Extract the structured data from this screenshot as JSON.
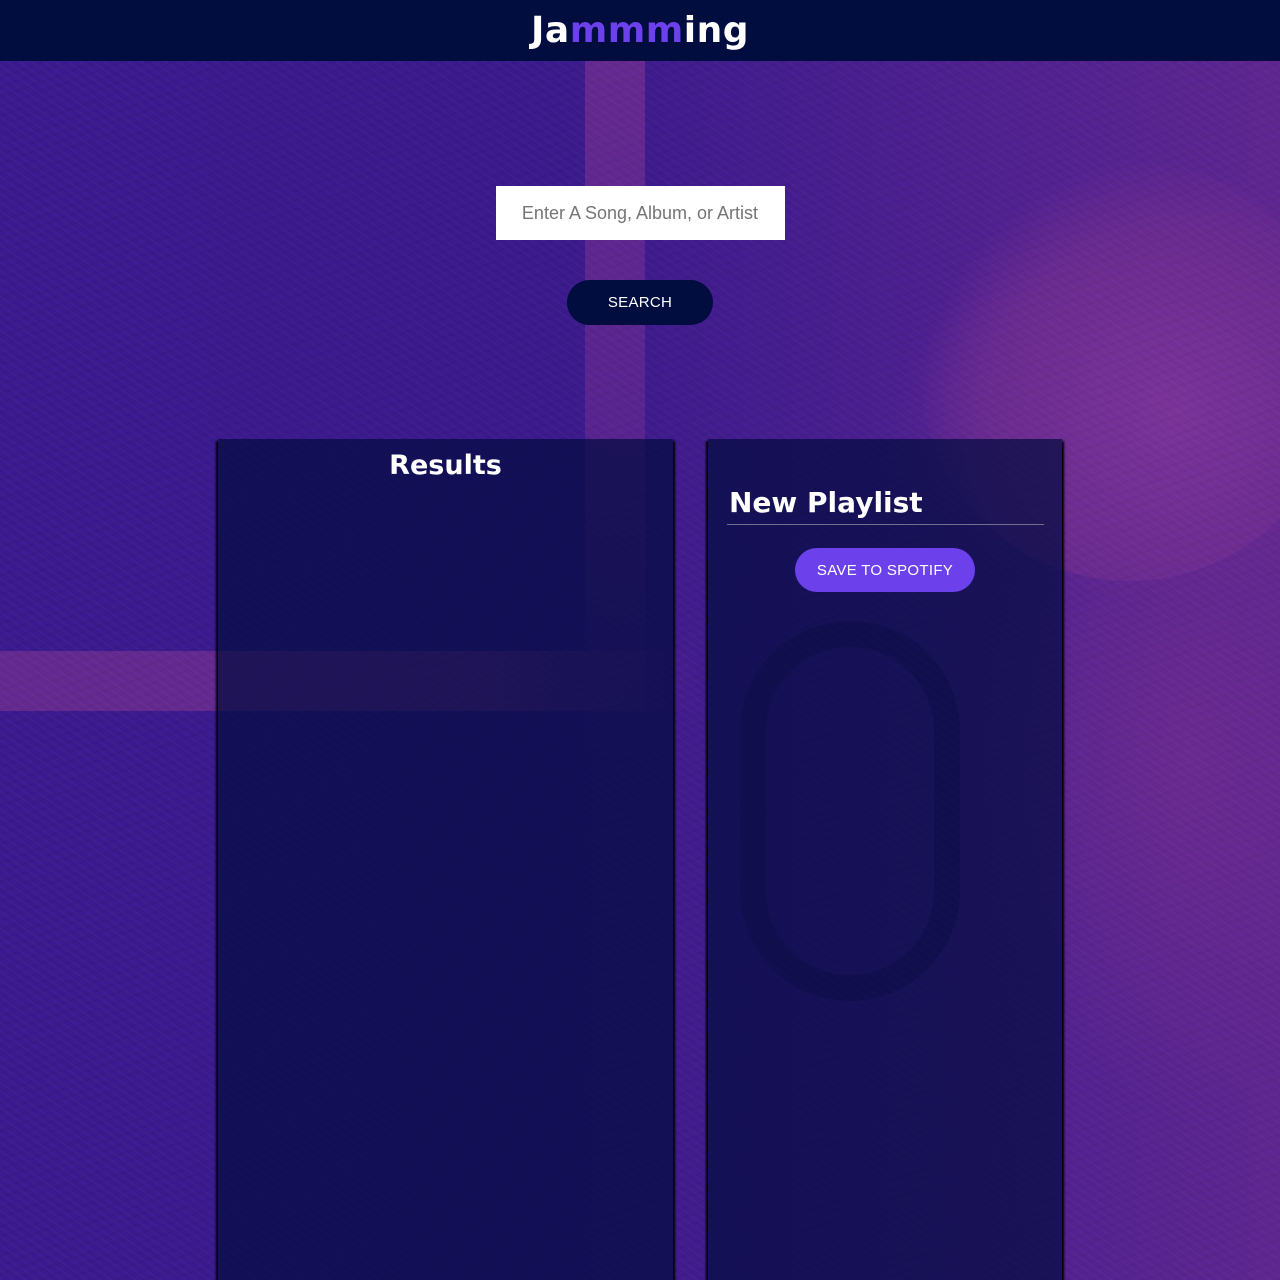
{
  "header": {
    "brand_prefix": "Ja",
    "brand_highlight": "mmm",
    "brand_suffix": "ing"
  },
  "search": {
    "placeholder": "Enter A Song, Album, or Artist",
    "value": "",
    "button_label": "SEARCH"
  },
  "results": {
    "title": "Results",
    "tracks": []
  },
  "playlist": {
    "name": "New Playlist",
    "save_label": "SAVE TO SPOTIFY",
    "tracks": []
  },
  "colors": {
    "header_bg": "#010c3f",
    "accent": "#6c41ec",
    "panel_bg": "rgba(1,12,63,0.7)"
  }
}
